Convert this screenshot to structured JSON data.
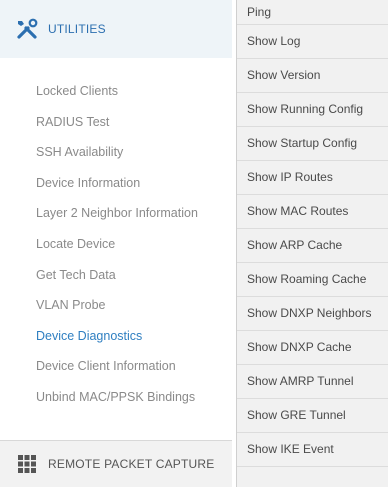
{
  "utilities": {
    "header_label": "UTILITIES",
    "items": [
      "Locked Clients",
      "RADIUS Test",
      "SSH Availability",
      "Device Information",
      "Layer 2 Neighbor Information",
      "Locate Device",
      "Get Tech Data",
      "VLAN Probe",
      "Device Diagnostics",
      "Device Client Information",
      "Unbind MAC/PPSK Bindings"
    ],
    "active_item": "Device Diagnostics"
  },
  "remote_capture": {
    "header_label": "REMOTE PACKET CAPTURE"
  },
  "diagnostics_menu": {
    "items": [
      "Ping",
      "Show Log",
      "Show Version",
      "Show Running Config",
      "Show Startup Config",
      "Show IP Routes",
      "Show MAC Routes",
      "Show ARP Cache",
      "Show Roaming Cache",
      "Show DNXP Neighbors",
      "Show DNXP Cache",
      "Show AMRP Tunnel",
      "Show GRE Tunnel",
      "Show IKE Event"
    ]
  },
  "colors": {
    "accent": "#2f7fc1",
    "muted_text": "#8a8a8a"
  },
  "icons": {
    "utilities": "tools-icon",
    "remote_capture": "grid-icon"
  }
}
